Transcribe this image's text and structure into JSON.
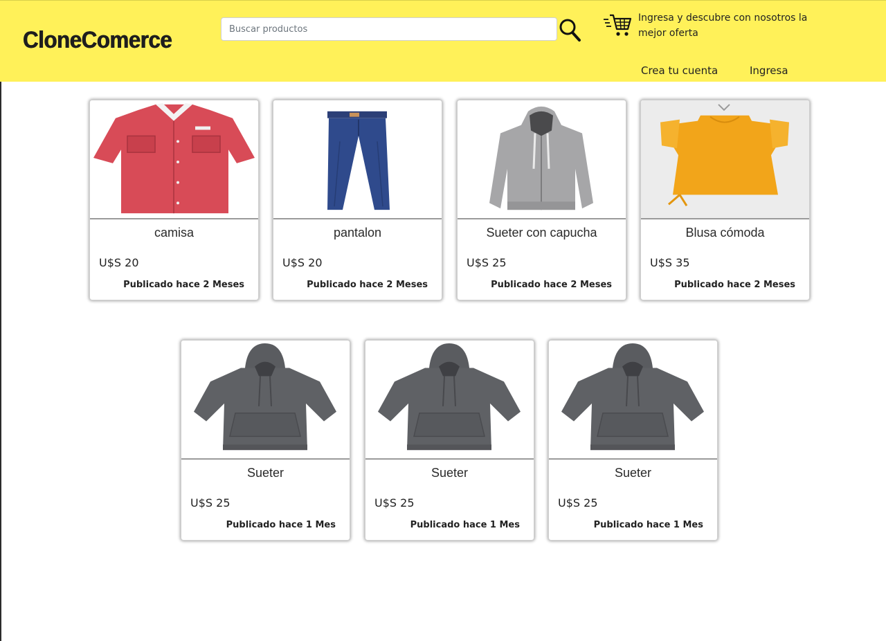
{
  "header": {
    "logo": "CloneComerce",
    "search": {
      "placeholder": "Buscar productos",
      "value": ""
    },
    "search_icon": "search-icon",
    "cart_icon": "shopping-cart-icon",
    "promo_text": "Ingresa y descubre con nosotros la mejor oferta",
    "nav": {
      "create_account": "Crea tu cuenta",
      "login": "Ingresa"
    },
    "background_color": "#fff159"
  },
  "products": [
    {
      "title": "camisa",
      "price": "U$S 20",
      "published": "Publicado hace 2 Meses",
      "image": "red-shirt"
    },
    {
      "title": "pantalon",
      "price": "U$S 20",
      "published": "Publicado hace 2 Meses",
      "image": "blue-pants"
    },
    {
      "title": "Sueter con capucha",
      "price": "U$S 25",
      "published": "Publicado hace 2 Meses",
      "image": "gray-zip-hoodie"
    },
    {
      "title": "Blusa cómoda",
      "price": "U$S 35",
      "published": "Publicado hace 2 Meses",
      "image": "yellow-blouse"
    },
    {
      "title": "Sueter",
      "price": "U$S 25",
      "published": "Publicado hace 1 Mes",
      "image": "dark-gray-hoodie"
    },
    {
      "title": "Sueter",
      "price": "U$S 25",
      "published": "Publicado hace 1 Mes",
      "image": "dark-gray-hoodie"
    },
    {
      "title": "Sueter",
      "price": "U$S 25",
      "published": "Publicado hace 1 Mes",
      "image": "dark-gray-hoodie"
    }
  ]
}
